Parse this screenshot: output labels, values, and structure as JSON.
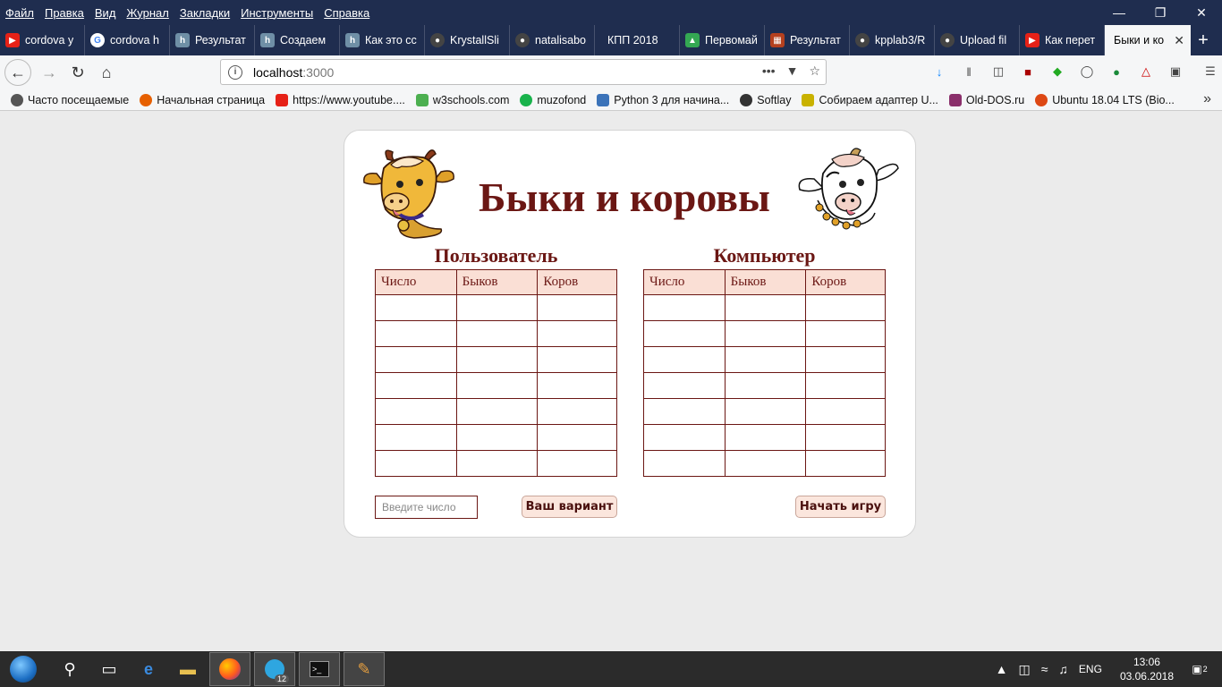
{
  "menu": [
    "Файл",
    "Правка",
    "Вид",
    "Журнал",
    "Закладки",
    "Инструменты",
    "Справка"
  ],
  "window_controls": [
    "minimize-icon",
    "restore-icon",
    "close-icon"
  ],
  "tabs": [
    {
      "label": "cordova y",
      "icon": "youtube-icon",
      "color": "#e62117"
    },
    {
      "label": "cordova h",
      "icon": "google-icon",
      "color": "#4285f4"
    },
    {
      "label": "Результат",
      "icon": "habr-icon",
      "color": "#6f8fa6"
    },
    {
      "label": "Создаем",
      "icon": "habr-icon",
      "color": "#6f8fa6"
    },
    {
      "label": "Как это сс",
      "icon": "habr-icon",
      "color": "#6f8fa6"
    },
    {
      "label": "KrystallSli",
      "icon": "github-icon",
      "color": "#444444"
    },
    {
      "label": "natalisabo",
      "icon": "github-icon",
      "color": "#444444"
    },
    {
      "label": "КПП 2018",
      "icon": "none",
      "color": "#1f2d4f"
    },
    {
      "label": "Первомай",
      "icon": "maps-icon",
      "color": "#34a853"
    },
    {
      "label": "Результат",
      "icon": "grid-icon",
      "color": "#b5401e"
    },
    {
      "label": "kpplab3/R",
      "icon": "github-icon",
      "color": "#444444"
    },
    {
      "label": "Upload fil",
      "icon": "github-icon",
      "color": "#444444"
    },
    {
      "label": "Как перет",
      "icon": "youtube-icon",
      "color": "#e62117"
    },
    {
      "label": "Быки и ко",
      "icon": "none",
      "color": "#ffffff",
      "active": true
    }
  ],
  "address": {
    "host": "localhost",
    "port": ":3000"
  },
  "bookmarks": [
    {
      "label": "Часто посещаемые",
      "color": "#555555"
    },
    {
      "label": "Начальная страница",
      "color": "#e66000"
    },
    {
      "label": "https://www.youtube....",
      "color": "#e62117"
    },
    {
      "label": "w3schools.com",
      "color": "#4caf50"
    },
    {
      "label": "muzofond",
      "color": "#19b34c"
    },
    {
      "label": "Python 3 для начина...",
      "color": "#3b73b9"
    },
    {
      "label": "Softlay",
      "color": "#333333"
    },
    {
      "label": "Собираем адаптер U...",
      "color": "#c9b200"
    },
    {
      "label": "Old-DOS.ru",
      "color": "#8a2f6b"
    },
    {
      "label": "Ubuntu 18.04 LTS (Bio...",
      "color": "#dd4814"
    }
  ],
  "game": {
    "title": "Быки и коровы",
    "user_title": "Пользователь",
    "computer_title": "Компьютер",
    "columns": [
      "Число",
      "Быков",
      "Коров"
    ],
    "row_count": 7,
    "input_placeholder": "Введите число",
    "guess_button": "Ваш вариант",
    "start_button": "Начать игру"
  },
  "colors": {
    "accent": "#6b1714",
    "header_bg": "#fadfd5",
    "button_bg": "#fbe6dd"
  },
  "taskbar": {
    "time": "13:06",
    "date": "03.06.2018",
    "lang": "ENG",
    "telegram_badge": "12",
    "notifications": "2"
  }
}
